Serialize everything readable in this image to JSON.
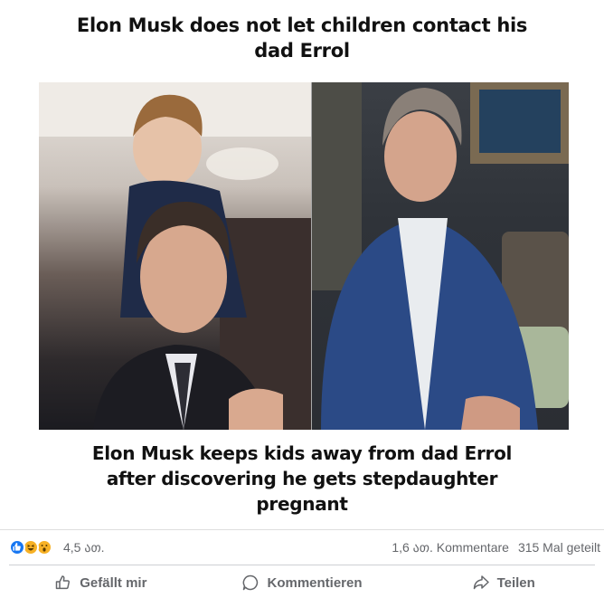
{
  "post": {
    "headline_top": [
      "Elon Musk does not let children contact his",
      "dad Errol"
    ],
    "headline_bottom": [
      "Elon Musk keeps kids away from dad Errol",
      "after discovering he gets stepdaughter",
      "pregnant"
    ]
  },
  "stats": {
    "reactions": [
      "like-icon",
      "haha-icon",
      "wow-icon"
    ],
    "reaction_count": "4,5 ათ.",
    "comments": "1,6 ათ. Kommentare",
    "shares": "315 Mal geteilt"
  },
  "actions": {
    "like_label": "Gefällt mir",
    "comment_label": "Kommentieren",
    "share_label": "Teilen"
  },
  "colors": {
    "like_blue": "#1877f2",
    "emoji_yellow": "#f7b125",
    "secondary_text": "#65676b"
  }
}
